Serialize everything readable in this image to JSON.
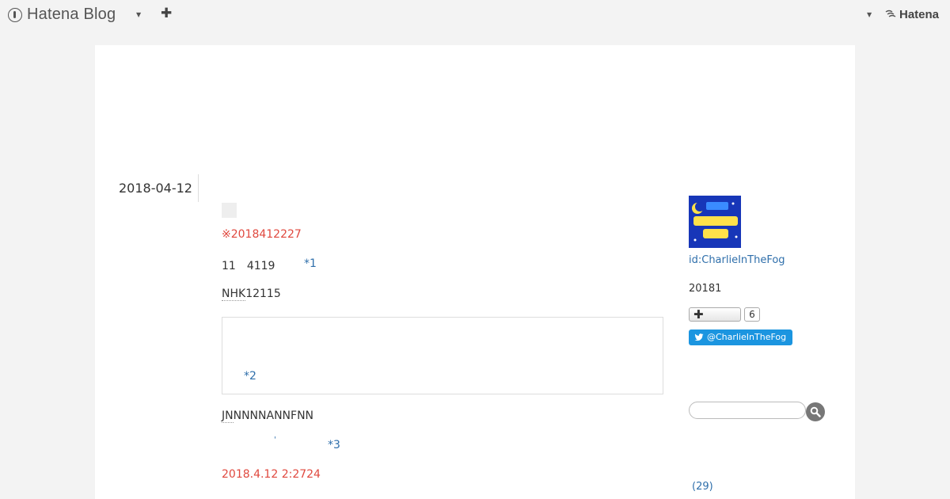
{
  "global_header": {
    "logo_text": "Hatena Blog",
    "right_brand": "Hatena"
  },
  "entry": {
    "date": "2018-04-12",
    "paragraphs": {
      "notice": "※2018412227",
      "p2_text": "11　4119",
      "p2_footnote": "*1",
      "p3_keyword": "NHK",
      "p3_rest": "12115",
      "quote_footnote": "*2",
      "p4_keyword": "JN",
      "p4_rest": "NNNNANNFNN",
      "p5_dot": "'",
      "p5_footnote": "*3",
      "updated": "2018.4.12 2:2724"
    }
  },
  "sidebar": {
    "profile_id": "id:CharlieInTheFog",
    "since": "20181",
    "reader_count": "6",
    "twitter_handle": "@CharlieInTheFog",
    "search_placeholder": "",
    "archive_count": "(29)"
  },
  "colors": {
    "accent_red": "#e0483e",
    "link_blue": "#2f6fab",
    "twitter_blue": "#1b95e0"
  }
}
